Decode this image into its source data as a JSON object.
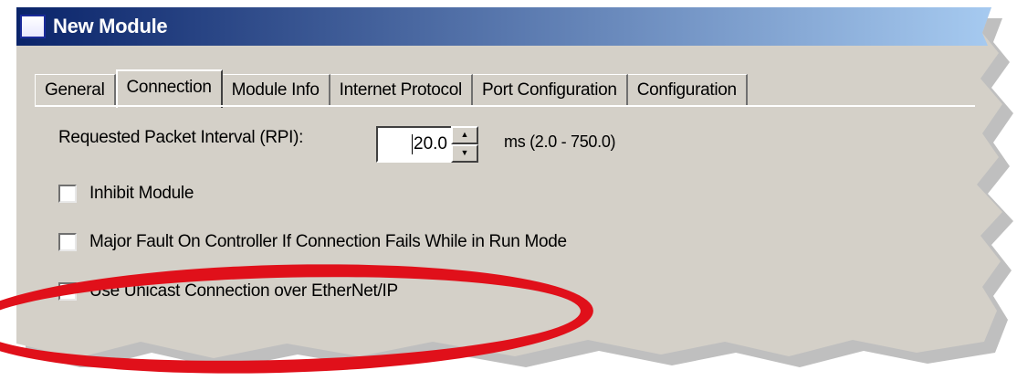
{
  "window": {
    "title": "New Module"
  },
  "tabs": [
    {
      "label": "General",
      "active": false
    },
    {
      "label": "Connection",
      "active": true
    },
    {
      "label": "Module Info",
      "active": false
    },
    {
      "label": "Internet Protocol",
      "active": false
    },
    {
      "label": "Port Configuration",
      "active": false
    },
    {
      "label": "Configuration",
      "active": false
    }
  ],
  "connection": {
    "rpi_label": "Requested Packet Interval (RPI):",
    "rpi_value": "20.0",
    "rpi_range": "ms (2.0 - 750.0)",
    "inhibit_label": "Inhibit Module",
    "inhibit_checked": false,
    "major_fault_label": "Major Fault On Controller If Connection Fails While in Run Mode",
    "major_fault_checked": false,
    "unicast_label": "Use Unicast Connection over EtherNet/IP",
    "unicast_checked": true
  },
  "colors": {
    "titlebar": "#0a246a",
    "dialog": "#d4d0c8",
    "highlight": "#e0101a"
  },
  "icons": [
    "window-icon",
    "spin-up-icon",
    "spin-down-icon",
    "checkmark-icon"
  ]
}
